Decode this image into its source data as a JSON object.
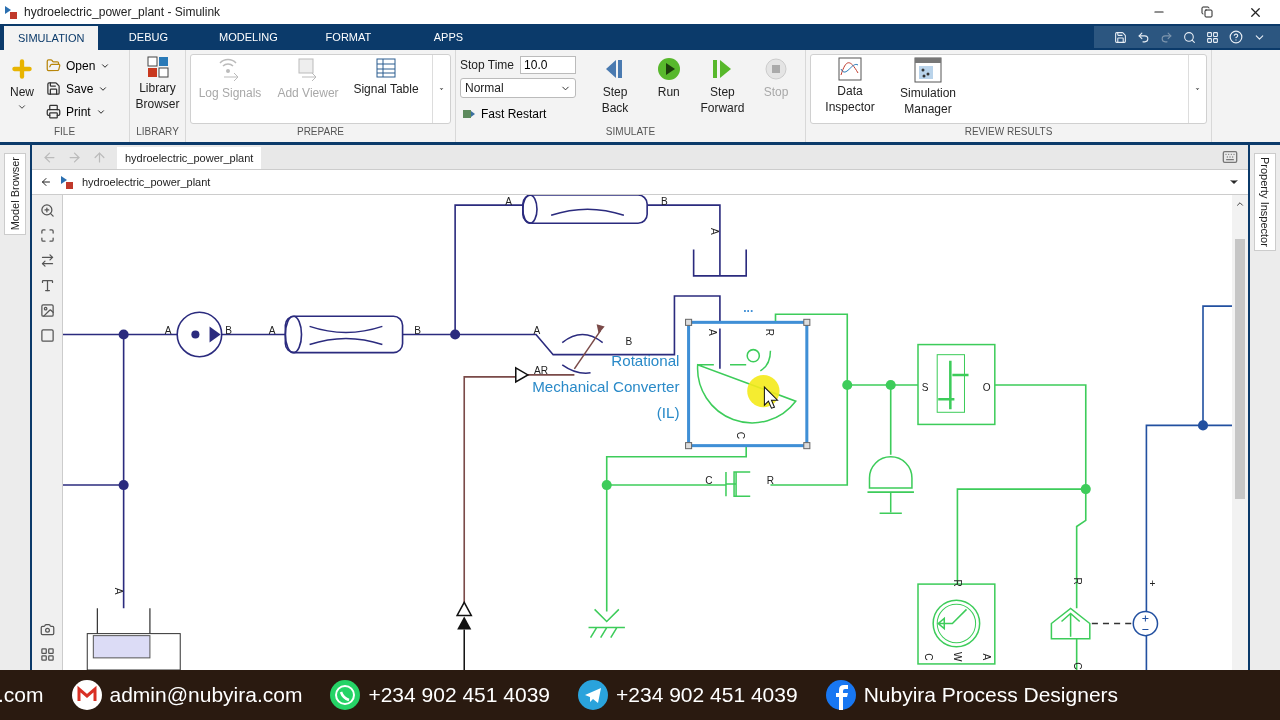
{
  "window": {
    "title": "hydroelectric_power_plant - Simulink"
  },
  "tabs": [
    {
      "label": "SIMULATION",
      "selected": true
    },
    {
      "label": "DEBUG",
      "selected": false
    },
    {
      "label": "MODELING",
      "selected": false
    },
    {
      "label": "FORMAT",
      "selected": false
    },
    {
      "label": "APPS",
      "selected": false
    }
  ],
  "ribbon": {
    "file": {
      "label": "FILE",
      "new": "New",
      "items": [
        "Open",
        "Save",
        "Print"
      ]
    },
    "library": {
      "label": "LIBRARY",
      "button": "Library Browser"
    },
    "prepare": {
      "label": "PREPARE",
      "buttons": [
        {
          "label": "Log Signals",
          "disabled": true
        },
        {
          "label": "Add Viewer",
          "disabled": true
        },
        {
          "label": "Signal Table",
          "disabled": false
        }
      ]
    },
    "simulate": {
      "label": "SIMULATE",
      "stop_time_label": "Stop Time",
      "stop_time": "10.0",
      "mode": "Normal",
      "fast_restart": "Fast Restart",
      "buttons": [
        {
          "label": "Step Back",
          "disabled": false
        },
        {
          "label": "Run",
          "disabled": false
        },
        {
          "label": "Step Forward",
          "disabled": false
        },
        {
          "label": "Stop",
          "disabled": true
        }
      ]
    },
    "review": {
      "label": "REVIEW RESULTS",
      "buttons": [
        "Data Inspector",
        "Simulation Manager"
      ]
    }
  },
  "explorer": {
    "tab": "hydroelectric_power_plant",
    "path": "hydroelectric_power_plant"
  },
  "side_tabs": {
    "left": "Model Browser",
    "right": "Property Inspector"
  },
  "diagram": {
    "block_label": [
      "Rotational",
      "Mechanical Converter",
      "(IL)"
    ],
    "block_menu": "...",
    "ports": [
      "A",
      "B",
      "A",
      "A",
      "B",
      "A",
      "B",
      "A",
      "B",
      "AR",
      "A",
      "R",
      "C",
      "C",
      "R",
      "S",
      "O",
      "R",
      "C",
      "W",
      "A",
      "R",
      "C",
      "+",
      "A"
    ]
  },
  "banner": [
    {
      "text": ".com"
    },
    {
      "text": "admin@nubyira.com"
    },
    {
      "text": "+234 902 451 4039"
    },
    {
      "text": "+234 902 451 4039"
    },
    {
      "text": "Nubyira Process Designers"
    }
  ]
}
